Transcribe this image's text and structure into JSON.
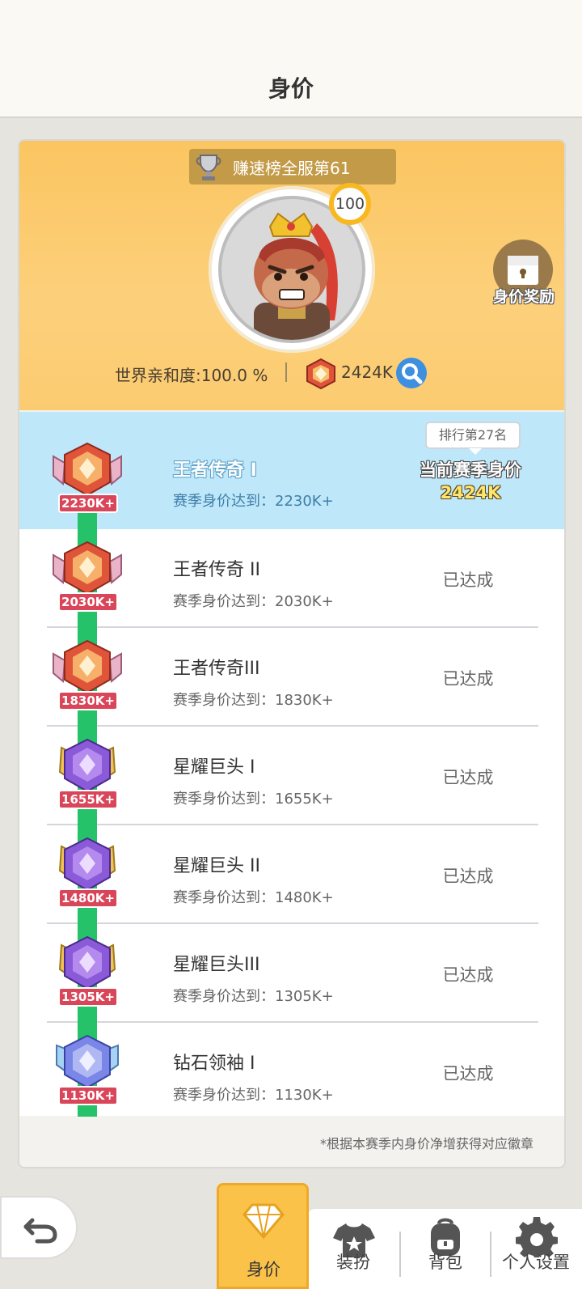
{
  "header": {
    "title": "身价"
  },
  "profile": {
    "rank_tag": "赚速榜全服第61",
    "level": "100",
    "reward_label": "身价奖励",
    "affinity": "世界亲和度:100.0 %",
    "value": "2424K"
  },
  "current": {
    "title": "王者传奇 I",
    "requirement": "赛季身价达到：2230K+",
    "rank_pill": "排行第27名",
    "season_label": "当前赛季身价",
    "season_value": "2424K",
    "badge": "2230K+"
  },
  "tiers": [
    {
      "title": "王者传奇 II",
      "requirement": "赛季身价达到：2030K+",
      "status": "已达成",
      "badge": "2030K+",
      "gem": "red"
    },
    {
      "title": "王者传奇III",
      "requirement": "赛季身价达到：1830K+",
      "status": "已达成",
      "badge": "1830K+",
      "gem": "red"
    },
    {
      "title": "星耀巨头 I",
      "requirement": "赛季身价达到：1655K+",
      "status": "已达成",
      "badge": "1655K+",
      "gem": "purple"
    },
    {
      "title": "星耀巨头 II",
      "requirement": "赛季身价达到：1480K+",
      "status": "已达成",
      "badge": "1480K+",
      "gem": "purple"
    },
    {
      "title": "星耀巨头III",
      "requirement": "赛季身价达到：1305K+",
      "status": "已达成",
      "badge": "1305K+",
      "gem": "purple"
    },
    {
      "title": "钻石领袖 I",
      "requirement": "赛季身价达到：1130K+",
      "status": "已达成",
      "badge": "1130K+",
      "gem": "blue"
    }
  ],
  "footnote": "*根据本赛季内身价净增获得对应徽章",
  "tabs": [
    {
      "label": "身价",
      "icon": "diamond-icon"
    },
    {
      "label": "装扮",
      "icon": "shirt-icon"
    },
    {
      "label": "背包",
      "icon": "backpack-icon"
    },
    {
      "label": "个人设置",
      "icon": "gear-icon"
    }
  ],
  "colors": {
    "accent": "#fbc24a",
    "track": "#25c26a",
    "current_row": "#bfe7fa",
    "badge_label": "#d9465a"
  }
}
